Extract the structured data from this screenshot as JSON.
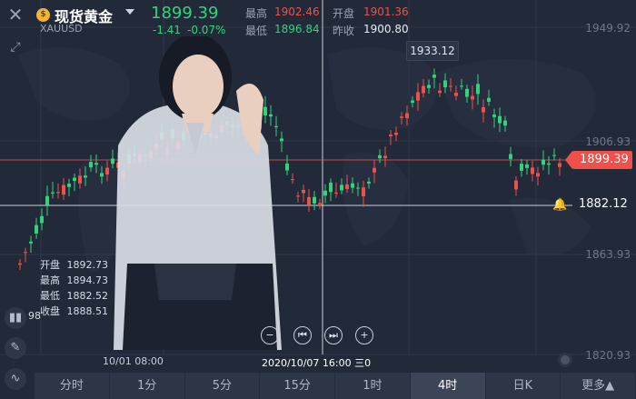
{
  "header": {
    "title": "现货黄金",
    "symbol": "XAUUSD",
    "price": "1899.39",
    "change": "-1.41",
    "change_pct": "-0.07%",
    "coin_glyph": "$",
    "stats": {
      "high_label": "最高",
      "high_value": "1902.46",
      "open_label": "开盘",
      "open_value": "1901.36",
      "low_label": "最低",
      "low_value": "1896.84",
      "prev_label": "昨收",
      "prev_value": "1900.80"
    }
  },
  "chart": {
    "price_axis": [
      "1949.92",
      "1906.93",
      "1863.93",
      "1820.93"
    ],
    "current_price": "1899.39",
    "cursor_price": "1882.12",
    "max_price": "1933.12",
    "colors": {
      "up": "#f0504a",
      "down": "#32d37a",
      "background": "#222a3a"
    }
  },
  "ohlc": {
    "open_label": "开盘",
    "open_value": "1892.73",
    "high_label": "最高",
    "high_value": "1894.73",
    "low_label": "最低",
    "low_value": "1882.52",
    "close_label": "收盘",
    "close_value": "1888.51"
  },
  "left_value": "98",
  "dates": {
    "left": "10/01 08:00",
    "cursor": "2020/10/07 16:00 三",
    "cursor_suffix": "0"
  },
  "tabs": [
    "分时",
    "1分",
    "5分",
    "15分",
    "1时",
    "4时",
    "日K",
    "更多▲"
  ],
  "active_tab": "4时"
}
